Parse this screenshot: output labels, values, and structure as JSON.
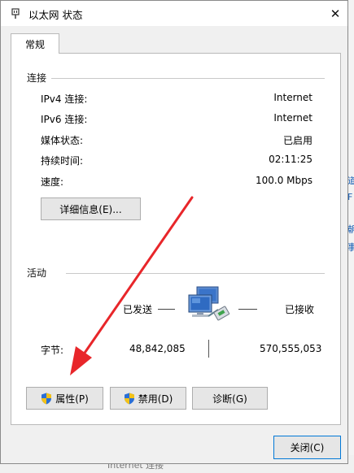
{
  "window": {
    "title": "以太网 状态",
    "close_glyph": "✕"
  },
  "tabs": [
    {
      "label": "常规"
    }
  ],
  "connection": {
    "label": "连接",
    "rows": [
      {
        "label": "IPv4 连接:",
        "value": "Internet"
      },
      {
        "label": "IPv6 连接:",
        "value": "Internet"
      },
      {
        "label": "媒体状态:",
        "value": "已启用"
      },
      {
        "label": "持续时间:",
        "value": "02:11:25"
      },
      {
        "label": "速度:",
        "value": "100.0 Mbps"
      }
    ],
    "details_button": "详细信息(E)..."
  },
  "activity": {
    "label": "活动",
    "sent_label": "已发送",
    "received_label": "已接收",
    "bytes_label": "字节:",
    "bytes_sent": "48,842,085",
    "bytes_received": "570,555,053"
  },
  "actions": {
    "properties": "属性(P)",
    "disable": "禁用(D)",
    "diagnose": "诊断(G)"
  },
  "footer": {
    "close": "关闭(C)"
  },
  "background": {
    "right_fragments": [
      "道",
      "F",
      "朝",
      "事"
    ],
    "bottom_fragment": "Internet 连接"
  },
  "colors": {
    "shield_blue": "#2a6fd6",
    "shield_yellow": "#f3c218",
    "arrow_red": "#e8262a",
    "focus_border": "#0078d7"
  },
  "icons": [
    "ethernet-icon",
    "close-icon",
    "shield-icon",
    "network-computers-icon",
    "red-arrow-annotation"
  ]
}
